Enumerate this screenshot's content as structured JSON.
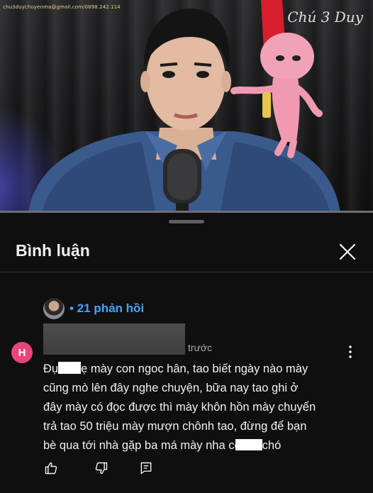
{
  "video": {
    "watermark_email": "chu3duychuyenma@gmail.com/0898.242.114",
    "watermark_logo": "Chú 3 Duy"
  },
  "sheet": {
    "title": "Bình luận"
  },
  "reply_thread": {
    "replies_label": "• 21 phản hồi",
    "icon": "avatar"
  },
  "comment": {
    "avatar_letter": "H",
    "avatar_color": "#e8457a",
    "time_suffix": "trước",
    "line1_pre": "Đụ",
    "line1_post": "ẹ mày con ngoc hân, tao biết ngày nào mày",
    "line2": "cũng mò lên đây nghe chuyện, bữa nay tao ghi ở",
    "line3": "đây mày có đọc được thì mày khôn hồn mày chuyển",
    "line4": "trả tao 50 triệu mày mượn chônh tao, đừng để bạn",
    "line5_pre": "bè qua tới nhà gặp ba má mày nha co",
    "line5_post": "chó"
  },
  "actions": {
    "like_icon": "thumbs-up-icon",
    "dislike_icon": "thumbs-down-icon",
    "reply_icon": "comment-reply-icon"
  },
  "colors": {
    "background": "#0f0f0f",
    "link": "#3ea6ff",
    "secondary_text": "#aaaaaa"
  }
}
